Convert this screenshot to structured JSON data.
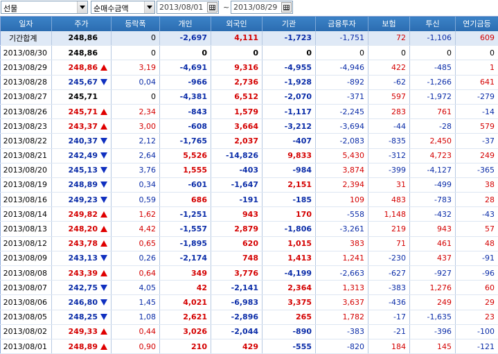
{
  "toolbar": {
    "market_select": "선물",
    "metric_select": "순매수금액",
    "date_from": "2013/08/01",
    "date_to": "2013/08/29",
    "range_sep": "~"
  },
  "colors": {
    "up": "#d40000",
    "down": "#0a2ca8",
    "header_bg": "#2f74bd",
    "summary_bg": "#dfe9f6"
  },
  "table": {
    "headers": [
      "일자",
      "주가",
      "등락폭",
      "개인",
      "외국인",
      "기관",
      "금융투자",
      "보험",
      "투신",
      "연기금등"
    ],
    "summary": {
      "date": "기간합계",
      "price": "248,86",
      "dir": "",
      "change": "0",
      "individual": "-2,697",
      "foreign": "4,111",
      "institution": "-1,723",
      "fininv": "-1,751",
      "insurance": "72",
      "trust": "-1,106",
      "pension": "609"
    },
    "rows": [
      {
        "date": "2013/08/30",
        "price": "248,86",
        "dir": "",
        "change": "0",
        "individual": "0",
        "foreign": "0",
        "institution": "0",
        "fininv": "0",
        "insurance": "0",
        "trust": "0",
        "pension": "0"
      },
      {
        "date": "2013/08/29",
        "price": "248,86",
        "dir": "up",
        "change": "3,19",
        "individual": "-4,691",
        "foreign": "9,316",
        "institution": "-4,955",
        "fininv": "-4,946",
        "insurance": "422",
        "trust": "-485",
        "pension": "1"
      },
      {
        "date": "2013/08/28",
        "price": "245,67",
        "dir": "down",
        "change": "0,04",
        "individual": "-966",
        "foreign": "2,736",
        "institution": "-1,928",
        "fininv": "-892",
        "insurance": "-62",
        "trust": "-1,266",
        "pension": "641"
      },
      {
        "date": "2013/08/27",
        "price": "245,71",
        "dir": "",
        "change": "0",
        "individual": "-4,381",
        "foreign": "6,512",
        "institution": "-2,070",
        "fininv": "-371",
        "insurance": "597",
        "trust": "-1,972",
        "pension": "-279"
      },
      {
        "date": "2013/08/26",
        "price": "245,71",
        "dir": "up",
        "change": "2,34",
        "individual": "-843",
        "foreign": "1,579",
        "institution": "-1,117",
        "fininv": "-2,245",
        "insurance": "283",
        "trust": "761",
        "pension": "-14"
      },
      {
        "date": "2013/08/23",
        "price": "243,37",
        "dir": "up",
        "change": "3,00",
        "individual": "-608",
        "foreign": "3,664",
        "institution": "-3,212",
        "fininv": "-3,694",
        "insurance": "-44",
        "trust": "-28",
        "pension": "579"
      },
      {
        "date": "2013/08/22",
        "price": "240,37",
        "dir": "down",
        "change": "2,12",
        "individual": "-1,765",
        "foreign": "2,037",
        "institution": "-407",
        "fininv": "-2,083",
        "insurance": "-835",
        "trust": "2,450",
        "pension": "-37"
      },
      {
        "date": "2013/08/21",
        "price": "242,49",
        "dir": "down",
        "change": "2,64",
        "individual": "5,526",
        "foreign": "-14,826",
        "institution": "9,833",
        "fininv": "5,430",
        "insurance": "-312",
        "trust": "4,723",
        "pension": "249"
      },
      {
        "date": "2013/08/20",
        "price": "245,13",
        "dir": "down",
        "change": "3,76",
        "individual": "1,555",
        "foreign": "-403",
        "institution": "-984",
        "fininv": "3,874",
        "insurance": "-399",
        "trust": "-4,127",
        "pension": "-365"
      },
      {
        "date": "2013/08/19",
        "price": "248,89",
        "dir": "down",
        "change": "0,34",
        "individual": "-601",
        "foreign": "-1,647",
        "institution": "2,151",
        "fininv": "2,394",
        "insurance": "31",
        "trust": "-499",
        "pension": "38"
      },
      {
        "date": "2013/08/16",
        "price": "249,23",
        "dir": "down",
        "change": "0,59",
        "individual": "686",
        "foreign": "-191",
        "institution": "-185",
        "fininv": "109",
        "insurance": "483",
        "trust": "-783",
        "pension": "28"
      },
      {
        "date": "2013/08/14",
        "price": "249,82",
        "dir": "up",
        "change": "1,62",
        "individual": "-1,251",
        "foreign": "943",
        "institution": "170",
        "fininv": "-558",
        "insurance": "1,148",
        "trust": "-432",
        "pension": "-43"
      },
      {
        "date": "2013/08/13",
        "price": "248,20",
        "dir": "up",
        "change": "4,42",
        "individual": "-1,557",
        "foreign": "2,879",
        "institution": "-1,806",
        "fininv": "-3,261",
        "insurance": "219",
        "trust": "943",
        "pension": "57"
      },
      {
        "date": "2013/08/12",
        "price": "243,78",
        "dir": "up",
        "change": "0,65",
        "individual": "-1,895",
        "foreign": "620",
        "institution": "1,015",
        "fininv": "383",
        "insurance": "71",
        "trust": "461",
        "pension": "48"
      },
      {
        "date": "2013/08/09",
        "price": "243,13",
        "dir": "down",
        "change": "0,26",
        "individual": "-2,174",
        "foreign": "748",
        "institution": "1,413",
        "fininv": "1,241",
        "insurance": "-230",
        "trust": "437",
        "pension": "-91"
      },
      {
        "date": "2013/08/08",
        "price": "243,39",
        "dir": "up",
        "change": "0,64",
        "individual": "349",
        "foreign": "3,776",
        "institution": "-4,199",
        "fininv": "-2,663",
        "insurance": "-627",
        "trust": "-927",
        "pension": "-96"
      },
      {
        "date": "2013/08/07",
        "price": "242,75",
        "dir": "down",
        "change": "4,05",
        "individual": "42",
        "foreign": "-2,141",
        "institution": "2,364",
        "fininv": "1,313",
        "insurance": "-383",
        "trust": "1,276",
        "pension": "60"
      },
      {
        "date": "2013/08/06",
        "price": "246,80",
        "dir": "down",
        "change": "1,45",
        "individual": "4,021",
        "foreign": "-6,983",
        "institution": "3,375",
        "fininv": "3,637",
        "insurance": "-436",
        "trust": "249",
        "pension": "29"
      },
      {
        "date": "2013/08/05",
        "price": "248,25",
        "dir": "down",
        "change": "1,08",
        "individual": "2,621",
        "foreign": "-2,896",
        "institution": "265",
        "fininv": "1,782",
        "insurance": "-17",
        "trust": "-1,635",
        "pension": "23"
      },
      {
        "date": "2013/08/02",
        "price": "249,33",
        "dir": "up",
        "change": "0,44",
        "individual": "3,026",
        "foreign": "-2,044",
        "institution": "-890",
        "fininv": "-383",
        "insurance": "-21",
        "trust": "-396",
        "pension": "-100"
      },
      {
        "date": "2013/08/01",
        "price": "248,89",
        "dir": "up",
        "change": "0,90",
        "individual": "210",
        "foreign": "429",
        "institution": "-555",
        "fininv": "-820",
        "insurance": "184",
        "trust": "145",
        "pension": "-121"
      }
    ]
  }
}
